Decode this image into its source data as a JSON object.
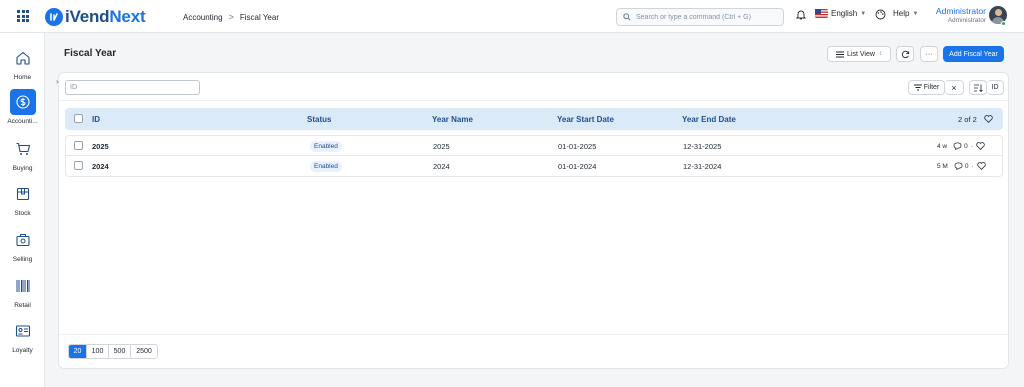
{
  "app": {
    "logo_main": "iVend",
    "logo_accent": "Next"
  },
  "breadcrumb": {
    "parent": "Accounting",
    "separator": ">",
    "current": "Fiscal Year"
  },
  "search": {
    "placeholder": "Search or type a command (Ctrl + G)"
  },
  "navbar": {
    "language": "English",
    "help": "Help",
    "user_name": "Administrator",
    "user_role": "Administrator"
  },
  "sidebar": {
    "items": [
      {
        "label": "Home",
        "icon": "home-icon",
        "active": false
      },
      {
        "label": "Accounti...",
        "icon": "dollar-icon",
        "active": true
      },
      {
        "label": "Buying",
        "icon": "cart-icon",
        "active": false
      },
      {
        "label": "Stock",
        "icon": "box-icon",
        "active": false
      },
      {
        "label": "Selling",
        "icon": "selling-icon",
        "active": false
      },
      {
        "label": "Retail",
        "icon": "barcode-icon",
        "active": false
      },
      {
        "label": "Loyalty",
        "icon": "loyalty-card-icon",
        "active": false
      }
    ]
  },
  "page": {
    "title": "Fiscal Year",
    "list_view_label": "List View",
    "more_label": "···",
    "add_label": "Add Fiscal Year"
  },
  "filters": {
    "id_placeholder": "ID",
    "filter_label": "Filter",
    "clear_label": "×",
    "sort_label": "ID"
  },
  "table": {
    "columns": [
      "ID",
      "Status",
      "Year Name",
      "Year Start Date",
      "Year End Date"
    ],
    "count": "2 of 2",
    "rows": [
      {
        "id": "2025",
        "status": "Enabled",
        "year_name": "2025",
        "start": "01-01-2025",
        "end": "12-31-2025",
        "age": "4 w",
        "comments": "0",
        "dot": "·"
      },
      {
        "id": "2024",
        "status": "Enabled",
        "year_name": "2024",
        "start": "01-01-2024",
        "end": "12-31-2024",
        "age": "5 M",
        "comments": "0",
        "dot": "·"
      }
    ]
  },
  "paging": {
    "options": [
      "20",
      "100",
      "500",
      "2500"
    ],
    "selected": "20"
  },
  "colors": {
    "accent": "#1a73e8",
    "brand_dark": "#1f4e8c",
    "header_bg": "#dbeaf9",
    "status_green": "#38a169"
  }
}
